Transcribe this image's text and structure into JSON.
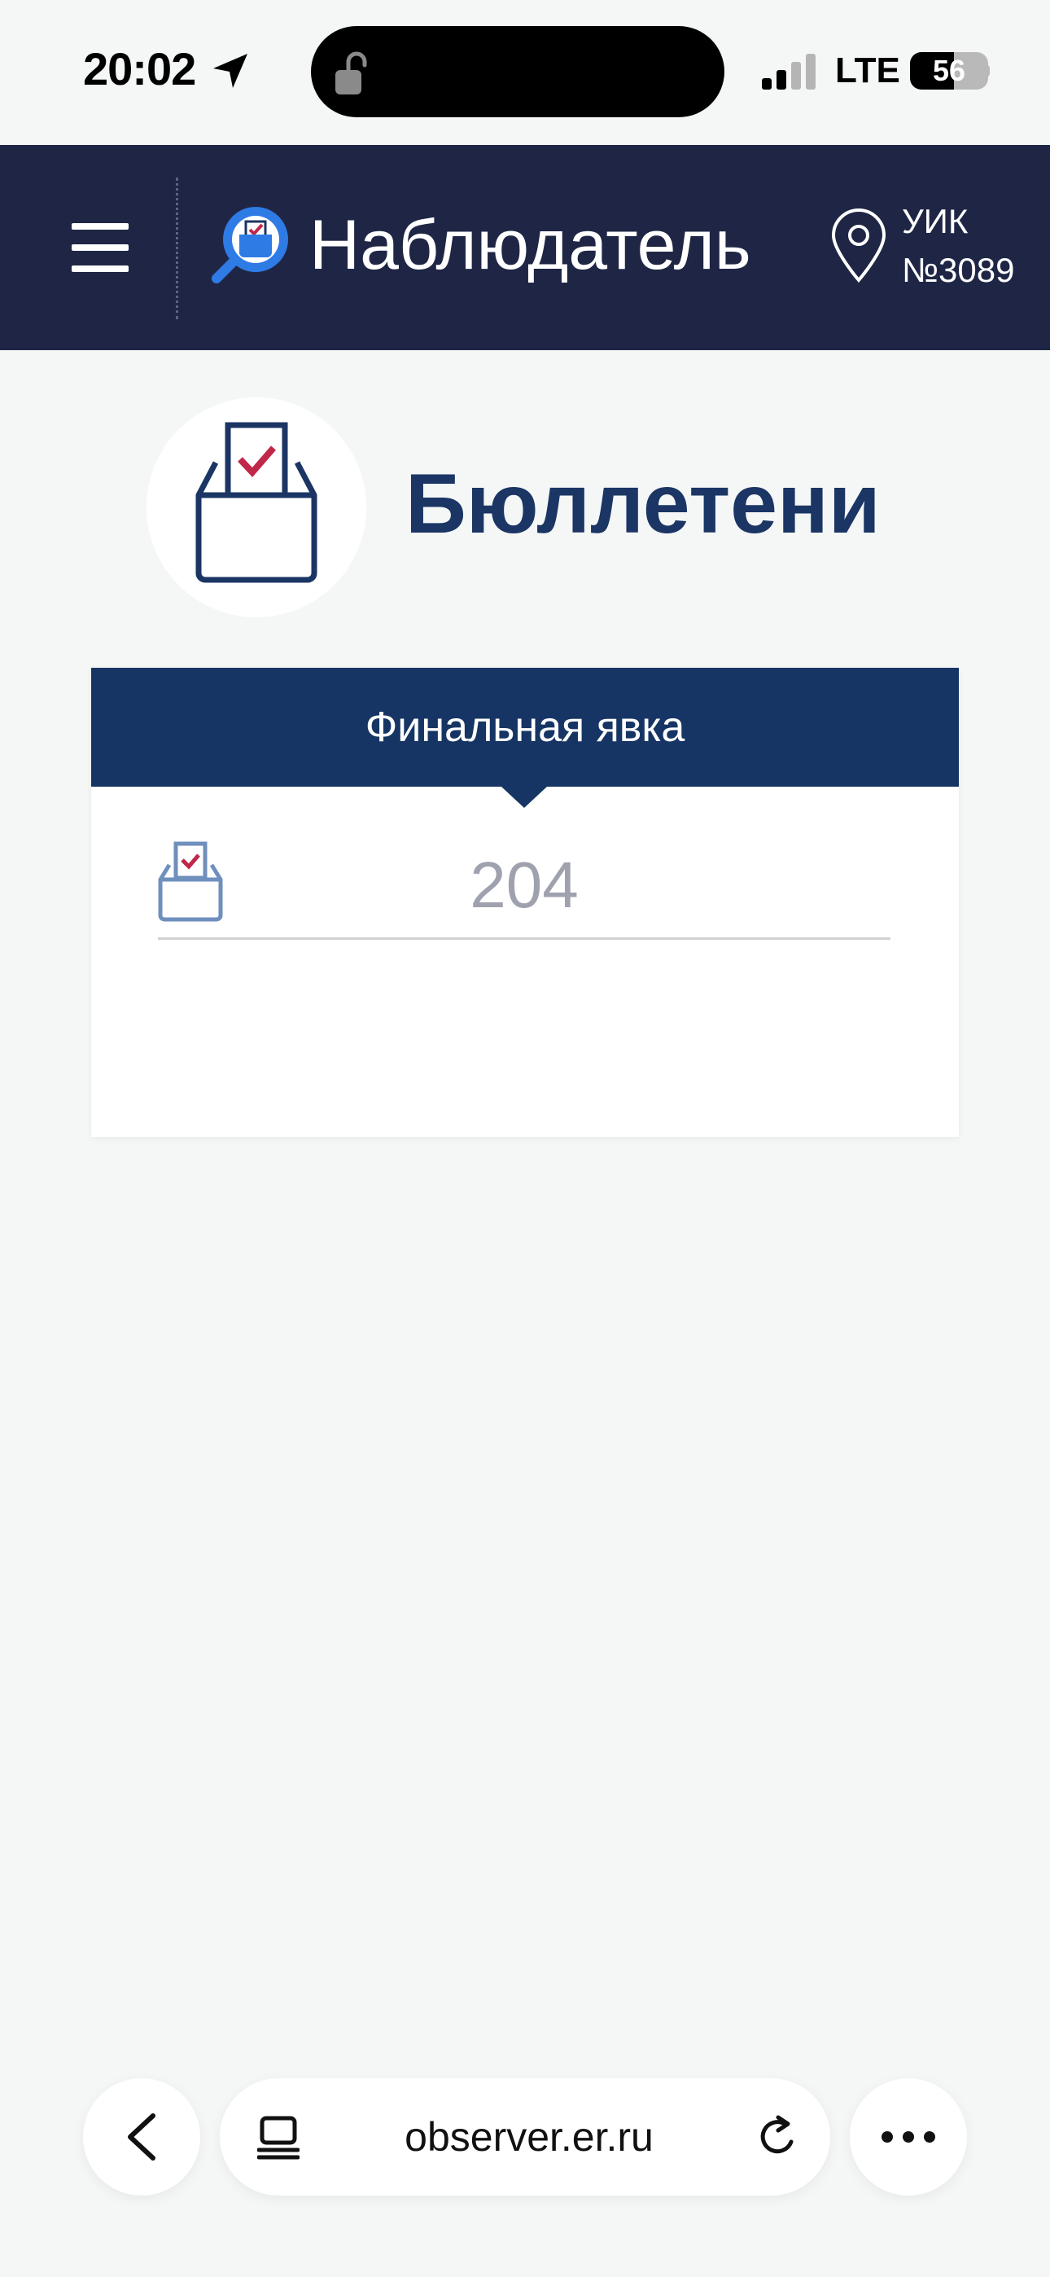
{
  "status_bar": {
    "time": "20:02",
    "network": "LTE",
    "battery_level": "56",
    "battery_fraction": 0.56
  },
  "header": {
    "app_title": "Наблюдатель",
    "uik_line1": "УИК",
    "uik_line2": "№3089"
  },
  "page": {
    "title": "Бюллетени"
  },
  "card": {
    "header": "Финальная явка",
    "count_value": "204"
  },
  "browser": {
    "url": "observer.er.ru"
  },
  "colors": {
    "header_bg": "#1f2645",
    "card_header_bg": "#163564",
    "title_color": "#1b3564",
    "accent_red": "#c0284a",
    "logo_blue": "#2f7be5"
  },
  "icons": {
    "location": "location-arrow-icon",
    "lock": "lock-open-icon",
    "menu": "hamburger-menu-icon",
    "logo": "observer-logo-icon",
    "pin": "map-pin-icon",
    "ballot": "ballot-box-icon",
    "back": "chevron-left-icon",
    "reader": "reader-mode-icon",
    "reload": "reload-icon",
    "more": "more-dots-icon"
  }
}
